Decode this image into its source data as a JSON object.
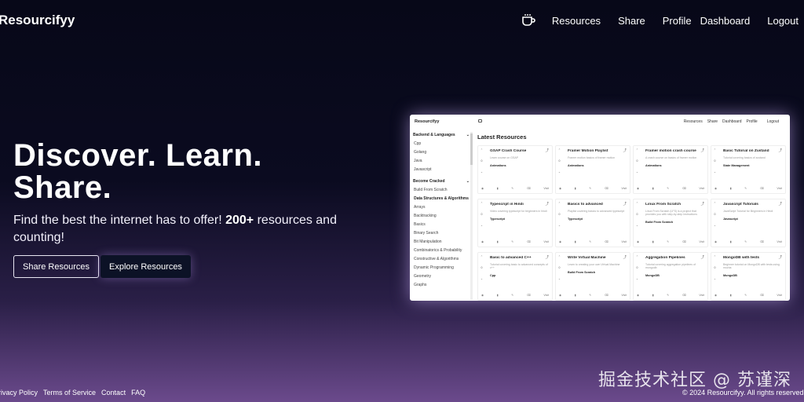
{
  "brand": "Resourcifyy",
  "nav": {
    "coffee_icon": "coffee-cup-icon",
    "links": [
      "Resources",
      "Share",
      "Profile",
      "Dashboard",
      "Logout"
    ]
  },
  "hero": {
    "title": "Discover. Learn. Share.",
    "subtitle_prefix": "Find the best the internet has to offer! ",
    "subtitle_bold": "200+",
    "subtitle_suffix": " resources and counting!",
    "share_button": "Share Resources",
    "explore_button": "Explore Resources"
  },
  "preview": {
    "brand": "Resourcifyy",
    "nav": [
      "Resources",
      "Share",
      "Dashboard",
      "Profile",
      "Logout"
    ],
    "sidebar": {
      "section1": "Backend & Languages",
      "items1": [
        "Cpp",
        "Golang",
        "Java",
        "Javascript"
      ],
      "section2": "Become Cracked",
      "items2": [
        "Build From Scratch"
      ],
      "sub": "Data Structures & Algorithms",
      "items3": [
        "Arrays",
        "Backtracking",
        "Basics",
        "Binary Search",
        "Bit Manipulation",
        "Combinatorics & Probability",
        "Constructive & Algorithms",
        "Dynamic Programming",
        "Geometry",
        "Graphs"
      ]
    },
    "heading": "Latest Resources",
    "cards": [
      {
        "title": "GSAP Crash Course",
        "desc": "Learn course on GSAP",
        "tag": "Animations"
      },
      {
        "title": "Framer Motion Playlist",
        "desc": "Framer motion basics of framer motion",
        "tag": "Animations"
      },
      {
        "title": "Framer motion crash course",
        "desc": "A crash course on basics of framer motion",
        "tag": "Animations"
      },
      {
        "title": "Basic Tutorial on Zustand",
        "desc": "Tutorial covering basics of zustand",
        "tag": "State Management"
      },
      {
        "title": "Typescript in Hindi",
        "desc": "Video covering typescript for beginners in hindi",
        "tag": "Typescript"
      },
      {
        "title": "Basics to advanced",
        "desc": "Playlist covering basics to advanced typescript",
        "tag": "Typescript"
      },
      {
        "title": "Linux From Scratch",
        "desc": "Linux From Scratch (LFS) is a project that provides you with step-by-step instructions",
        "tag": "Build From Scratch"
      },
      {
        "title": "Javascript Tutorials",
        "desc": "JavaScript Tutorial for Beginners in Hindi",
        "tag": "Javascript"
      },
      {
        "title": "Basic to advanced C++",
        "desc": "Tutorial covering basic to advanced concepts of c++",
        "tag": "Cpp"
      },
      {
        "title": "Write Virtual Machine",
        "desc": "Learn to creating your own Virtual Machine",
        "tag": "Build From Scratch"
      },
      {
        "title": "Aggregation Pipelines",
        "desc": "Tutorial covering aggregation pipelines of mongodb",
        "tag": "MongoDB"
      },
      {
        "title": "MongoDB with tests",
        "desc": "Beginner tutorial on MongoDB with tests using mocha",
        "tag": "MongoDB"
      },
      {
        "title": "Crash Course",
        "desc": "",
        "tag": ""
      },
      {
        "title": "MongoDB Tutorial",
        "desc": "",
        "tag": ""
      },
      {
        "title": "C++ for beginners",
        "desc": "",
        "tag": ""
      },
      {
        "title": "C++ basic to advanced",
        "desc": "",
        "tag": ""
      }
    ],
    "visit_label": "Visit"
  },
  "footer": {
    "links": [
      "Privacy Policy",
      "Terms of Service",
      "Contact",
      "FAQ"
    ],
    "copyright": "© 2024 Resourcifyy. All rights reserved."
  },
  "watermark": "掘金技术社区 @ 苏谨深"
}
